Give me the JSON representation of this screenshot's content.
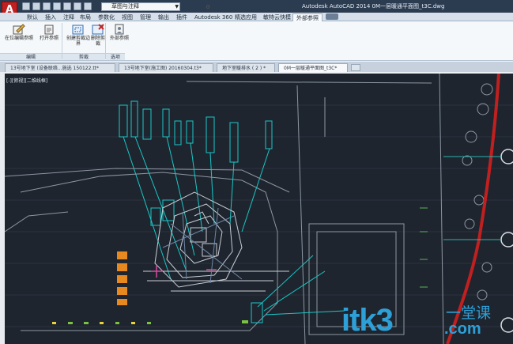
{
  "window": {
    "title": "Autodesk AutoCAD 2014    0M一层暖通平面图_t3C.dwg",
    "logo_glyph": "A",
    "workspace": "草图与注释"
  },
  "ribbon_tabs": [
    "默认",
    "插入",
    "注释",
    "布局",
    "参数化",
    "视图",
    "管理",
    "输出",
    "插件",
    "Autodesk 360",
    "精选应用",
    "敏特云快模",
    "外部参照"
  ],
  "active_tab": "外部参照",
  "ribbon": {
    "buttons": [
      {
        "label": "在位编辑参照",
        "icon": "edit-reference-icon"
      },
      {
        "label": "打开参照",
        "icon": "open-reference-icon"
      },
      {
        "label": "创建剪裁边界",
        "icon": "create-clip-boundary-icon"
      },
      {
        "label": "删除剪裁",
        "icon": "delete-clip-icon"
      },
      {
        "label": "外部参照",
        "icon": "external-reference-icon"
      }
    ],
    "groups": [
      "编辑",
      "剪裁",
      "选项"
    ]
  },
  "file_tabs": [
    "13号地下室 (设备联络...施选 150122.tt*",
    "13号地下室(施工图) 20160304.t3*",
    "地下室暖排水 ( 2 ) *",
    "0M一层暖通平面图_t3C*"
  ],
  "active_file_tab": "0M一层暖通平面图_t3C*",
  "viewport_label": "[-][俯视][二维线框]",
  "watermark": {
    "brand": "itk3",
    "cn": "一堂课",
    ".com": ".com"
  },
  "colors": {
    "canvas": "#1f252e",
    "accent_red": "#c0201f",
    "cyan": "#18c8c8",
    "orange": "#e8891f",
    "watermark": "#2ea0d8"
  }
}
